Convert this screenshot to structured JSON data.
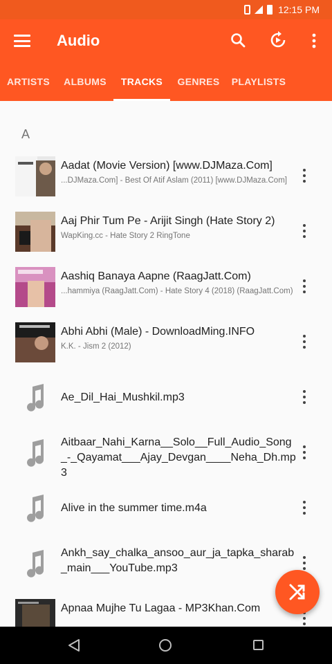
{
  "status_bar": {
    "time": "12:15 PM"
  },
  "app_bar": {
    "title": "Audio"
  },
  "tabs": [
    "ARTISTS",
    "ALBUMS",
    "TRACKS",
    "GENRES",
    "PLAYLISTS"
  ],
  "active_tab": "TRACKS",
  "section_header": "A",
  "tracks": [
    {
      "title": "Aadat (Movie Version) [www.DJMaza.Com]",
      "subtitle": "...DJMaza.Com] - Best Of Atif Aslam (2011) [www.DJMaza.Com]",
      "art": "album-art"
    },
    {
      "title": "Aaj Phir Tum Pe - Arijit Singh (Hate Story 2)",
      "subtitle": "WapKing.cc - Hate Story 2 RingTone",
      "art": "album-art"
    },
    {
      "title": "Aashiq Banaya Aapne (RaagJatt.Com)",
      "subtitle": "...hammiya (RaagJatt.Com) - Hate Story 4 (2018) (RaagJatt.Com)",
      "art": "album-art"
    },
    {
      "title": "Abhi Abhi (Male)  - DownloadMing.INFO",
      "subtitle": "K.K. - Jism 2 (2012)",
      "art": "album-art"
    },
    {
      "title": "Ae_Dil_Hai_Mushkil.mp3",
      "subtitle": "",
      "art": "music-note-icon"
    },
    {
      "title": "Aitbaar_Nahi_Karna__Solo__Full_Audio_Song_-_Qayamat___Ajay_Devgan____Neha_Dh.mp3",
      "subtitle": "",
      "art": "music-note-icon"
    },
    {
      "title": "Alive in the summer time.m4a",
      "subtitle": "",
      "art": "music-note-icon"
    },
    {
      "title": "Ankh_say_chalka_ansoo_aur_ja_tapka_sharab_main___YouTube.mp3",
      "subtitle": "",
      "art": "music-note-icon"
    },
    {
      "title": "Apnaa Mujhe Tu Lagaa - MP3Khan.Com",
      "subtitle": "",
      "art": "album-art"
    }
  ],
  "colors": {
    "accent": "#ff5722",
    "status_bar": "#f05a1e",
    "background": "#fafafa"
  }
}
